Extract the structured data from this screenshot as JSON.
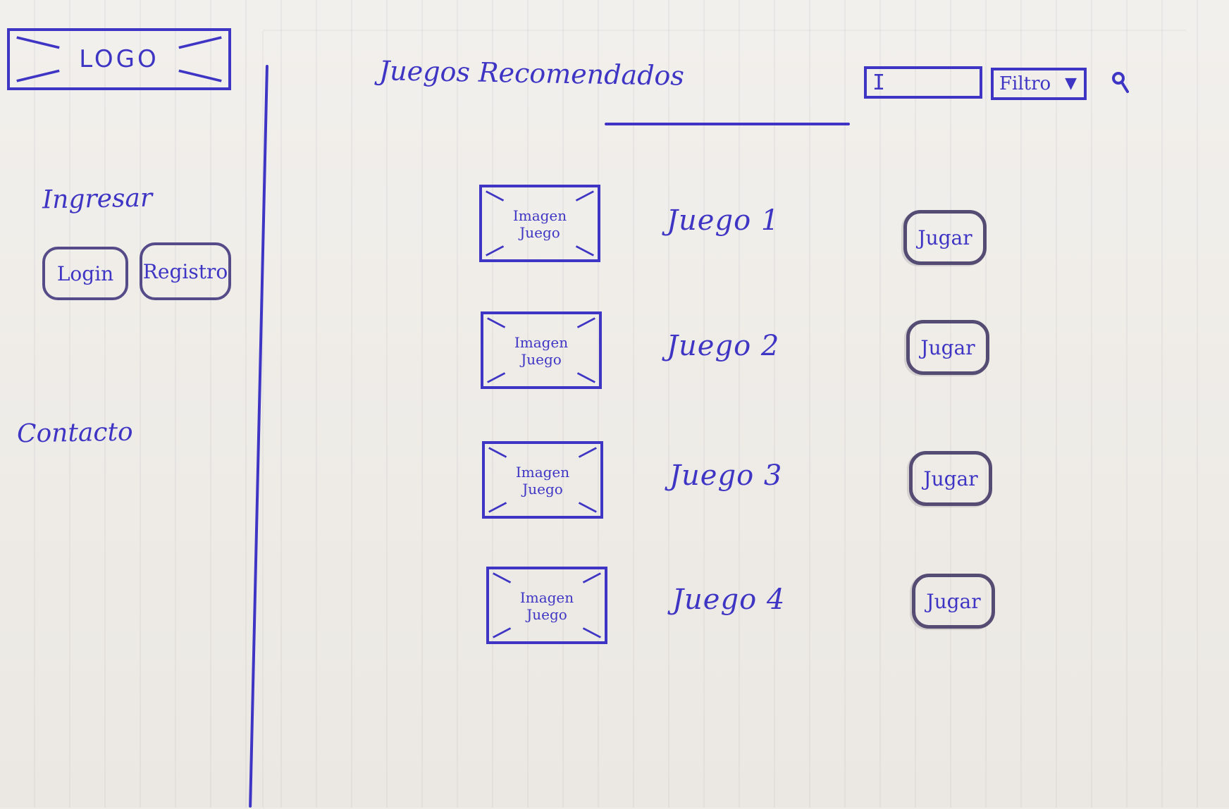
{
  "brand": {
    "logo_text": "LOGO"
  },
  "sidebar": {
    "login_section_title": "Ingresar",
    "login_button_label": "Login",
    "register_button_label": "Registro",
    "contact_label": "Contacto"
  },
  "main": {
    "title": "Juegos Recomendados",
    "search": {
      "value": "I",
      "filter_label": "Filtro"
    },
    "games": [
      {
        "image_label": "Imagen\nJuego",
        "title": "Juego 1",
        "play_label": "Jugar"
      },
      {
        "image_label": "Imagen\nJuego",
        "title": "Juego 2",
        "play_label": "Jugar"
      },
      {
        "image_label": "Imagen\nJuego",
        "title": "Juego 3",
        "play_label": "Jugar"
      },
      {
        "image_label": "Imagen\nJuego",
        "title": "Juego 4",
        "play_label": "Jugar"
      }
    ]
  },
  "icons": {
    "filter_dropdown": "chevron-down-icon",
    "search": "search-icon",
    "image_placeholder": "image-placeholder-icon"
  },
  "colors": {
    "ink": "#3f35c4",
    "paper": "#eeebe6",
    "button_outline": "#554b89"
  }
}
